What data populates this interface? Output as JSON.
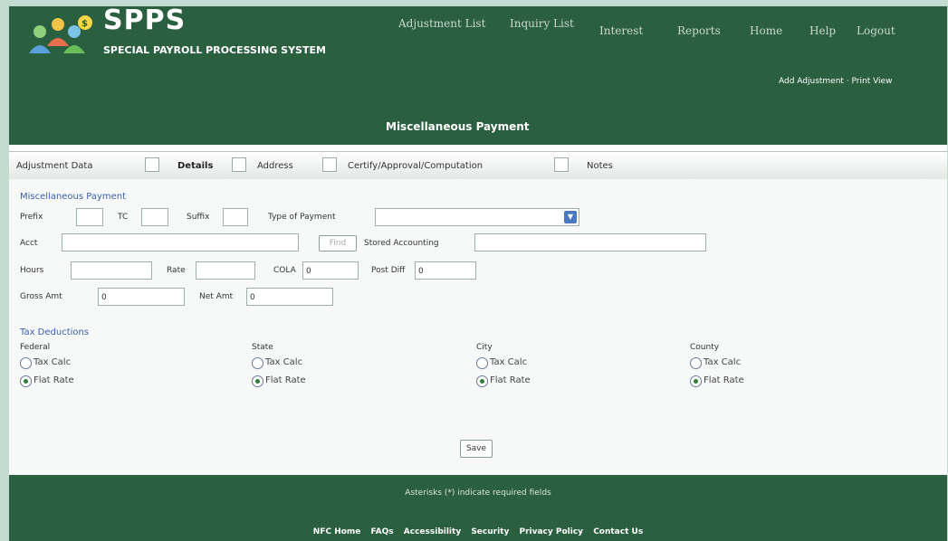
{
  "app": {
    "title": "SPPS",
    "subtitle": "SPECIAL PAYROLL PROCESSING SYSTEM"
  },
  "nav": {
    "adjustment_list": "Adjustment List",
    "inquiry_list": "Inquiry List",
    "interest": "Interest",
    "reports": "Reports",
    "home": "Home",
    "help": "Help",
    "logout": "Logout"
  },
  "util_links": "Add Adjustment · Print View",
  "page_title": "Miscellaneous Payment",
  "tabs": [
    {
      "label": "Adjustment Data"
    },
    {
      "label": "Details"
    },
    {
      "label": "Address"
    },
    {
      "label": "Certify/Approval/Computation"
    },
    {
      "label": "Notes"
    }
  ],
  "form": {
    "section_title": "Miscellaneous Payment",
    "prefix_label": "Prefix",
    "tc_label": "TC",
    "suffix_label": "Suffix",
    "type_of_payment_label": "Type of Payment",
    "acct_label": "Acct",
    "find_button": "Find",
    "stored_accounting_label": "Stored Accounting",
    "hours_label": "Hours",
    "rate_label": "Rate",
    "cola_label": "COLA",
    "cola_value": "0",
    "post_diff_label": "Post Diff",
    "post_diff_value": "0",
    "gross_amt_label": "Gross Amt",
    "gross_amt_value": "0",
    "net_amt_label": "Net Amt",
    "net_amt_value": "0",
    "tax_section_title": "Tax Deductions",
    "tax_groups": [
      {
        "label": "Federal",
        "option1": "Tax Calc",
        "option2": "Flat Rate"
      },
      {
        "label": "State",
        "option1": "Tax Calc",
        "option2": "Flat Rate"
      },
      {
        "label": "City",
        "option1": "Tax Calc",
        "option2": "Flat Rate"
      },
      {
        "label": "County",
        "option1": "Tax Calc",
        "option2": "Flat Rate"
      }
    ],
    "save_button": "Save"
  },
  "footer": {
    "note": "Asterisks (*) indicate required fields",
    "links": [
      "NFC Home",
      "FAQs",
      "Accessibility",
      "Security",
      "Privacy Policy",
      "Contact Us"
    ]
  },
  "colors": {
    "header_green": "#2a5f3f",
    "frame_mint": "#c3dcd2",
    "section_blue": "#3a5fae"
  }
}
